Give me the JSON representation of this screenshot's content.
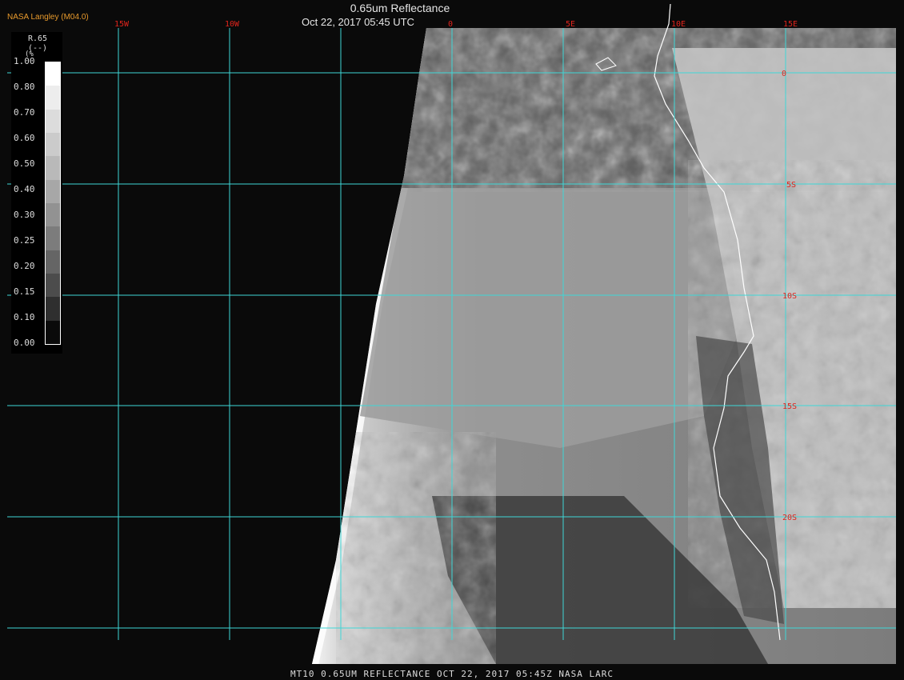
{
  "header": {
    "org": "NASA Langley (M04.0)",
    "title": "0.65um Reflectance",
    "datetime": "Oct 22, 2017 05:45 UTC"
  },
  "legend": {
    "param": "R.65",
    "unit": "(--)",
    "unit_prefix": "(%",
    "ticks": [
      "1.00",
      "0.80",
      "0.70",
      "0.60",
      "0.50",
      "0.40",
      "0.30",
      "0.25",
      "0.20",
      "0.15",
      "0.10",
      "0.00"
    ],
    "swatch_colors": [
      "#ffffff",
      "#ededed",
      "#dcdcdc",
      "#cbcbcb",
      "#b9b9b9",
      "#a7a7a7",
      "#929292",
      "#7c7c7c",
      "#656565",
      "#4c4c4c",
      "#2f2f2f",
      "#0a0a0a"
    ]
  },
  "map": {
    "lon_labels": [
      "15W",
      "10W",
      "0",
      "5E",
      "10E",
      "15E"
    ],
    "lat_labels": [
      "0",
      "5S",
      "10S",
      "15S",
      "20S"
    ],
    "grid_color": "#3ed7d7",
    "label_color": "#e0241c",
    "coast_color": "#ffffff"
  },
  "footer": {
    "text": "MT10  0.65UM REFLECTANCE   OCT 22, 2017 05:45Z   NASA LARC"
  }
}
